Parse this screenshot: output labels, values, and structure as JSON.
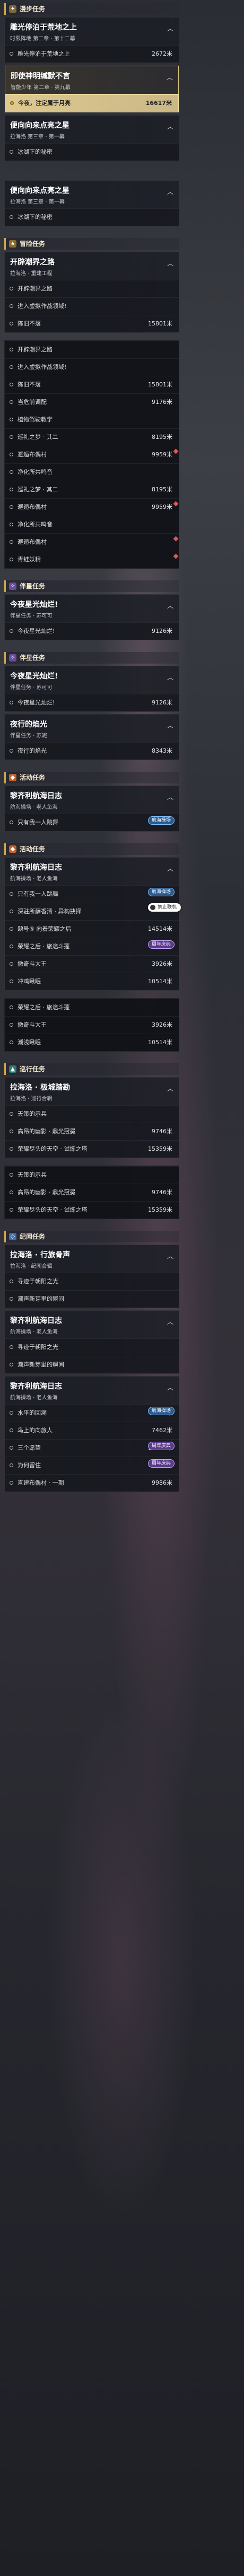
{
  "colors": {
    "accent_gold": "#cfa64a",
    "highlight": "#e8d296",
    "pin_red": "#e05555"
  },
  "s1": {
    "hdr": "漫步任务",
    "c1": {
      "title": "雕光停泊于荒地之上",
      "sub": "时限阵地 第二章 · 第十二幕",
      "rows": [
        {
          "t": "雕光停泊于荒地之上",
          "d": "2672米"
        }
      ]
    },
    "c2": {
      "title": "即使神明缄默不言",
      "sub": "智能少年 第二章 · 第九幕"
    },
    "c3": {
      "row": {
        "t": "今夜，注定属于月亮",
        "d": "16617米"
      }
    },
    "c4": {
      "title": "便向向来点亮之星",
      "sub": "拉海洛 第三章 · 第一幕",
      "rows": [
        {
          "t": "冰湖下的秘密",
          "d": ""
        }
      ]
    }
  },
  "s2": {
    "c1": {
      "title": "便向向来点亮之星",
      "sub": "拉海洛 第三章 · 第一幕",
      "rows": [
        {
          "t": "冰湖下的秘密",
          "d": ""
        }
      ]
    }
  },
  "s3": {
    "hdr": "冒险任务",
    "c1": {
      "title": "开辟潮界之路",
      "sub": "拉海洛 · 重建工程",
      "rows": [
        {
          "t": "开辟潮界之路",
          "d": ""
        },
        {
          "t": "进入虚拟作战领域!",
          "d": ""
        },
        {
          "t": "陈旧不落",
          "d": "15801米"
        }
      ]
    },
    "c2": {
      "rows": [
        {
          "t": "开辟潮界之路",
          "d": ""
        },
        {
          "t": "进入虚拟作战领域!",
          "d": ""
        },
        {
          "t": "陈旧不落",
          "d": "15801米"
        },
        {
          "t": "当危前调配",
          "d": "9176米"
        },
        {
          "t": "植物驾驶教学",
          "d": ""
        },
        {
          "t": "巡礼之梦 · 其二",
          "d": "8195米"
        },
        {
          "t": "邂逅布偶村",
          "d": "9959米"
        },
        {
          "t": "净化所共鸣音",
          "d": ""
        },
        {
          "t": "巡礼之梦 · 其二",
          "d": "8195米"
        },
        {
          "t": "邂逅布偶村",
          "d": "9959米"
        },
        {
          "t": "净化所共鸣音",
          "d": ""
        },
        {
          "t": "邂逅布偶村",
          "d": ""
        },
        {
          "t": "青蛙妖精",
          "d": ""
        }
      ]
    }
  },
  "s4": {
    "hdr": "伴星任务",
    "c1": {
      "title": "今夜星光灿烂!",
      "sub": "伴星任务 · 苏可可",
      "rows": [
        {
          "t": "今夜星光灿烂!",
          "d": "9126米"
        }
      ]
    }
  },
  "s5": {
    "hdr": "伴星任务",
    "c1": {
      "title": "今夜星光灿烂!",
      "sub": "伴星任务 · 苏可可",
      "rows": [
        {
          "t": "今夜星光灿烂!",
          "d": "9126米"
        }
      ]
    },
    "c2": {
      "title": "夜行的焰光",
      "sub": "伴星任务 · 苏妮",
      "rows": [
        {
          "t": "夜行的焰光",
          "d": "8343米"
        }
      ]
    }
  },
  "s6": {
    "hdr": "活动任务",
    "c1": {
      "title": "黎齐利航海日志",
      "sub": "航海操场 · 老人鱼海",
      "rows": [
        {
          "t": "只有我一人跳舞",
          "d": "7489米",
          "mkr": "航海操场"
        }
      ]
    }
  },
  "s7": {
    "hdr": "活动任务",
    "c1": {
      "title": "黎齐利航海日志",
      "sub": "航海操场 · 老人鱼海",
      "rows": [
        {
          "t": "只有我一人跳舞",
          "d": "7489米",
          "mkr": "航海操场"
        },
        {
          "t": "深驻所薛香清 · 异构抉择",
          "d": "",
          "btn": "禁止联机"
        },
        {
          "t": "题号⑤ 向着荣耀之后",
          "d": "14514米"
        },
        {
          "t": "荣耀之后 · 旅途斗蓬",
          "d": "",
          "mkr": "周年庆典"
        },
        {
          "t": "撒奇斗大王",
          "d": "3926米"
        },
        {
          "t": "冲鸡瞅眠",
          "d": "10514米"
        },
        {
          "t": "荣耀之后 · 旅途斗蓬",
          "d": ""
        },
        {
          "t": "撒奇斗大王",
          "d": "3926米"
        },
        {
          "t": "潮浅瞅眠",
          "d": "10514米"
        }
      ]
    }
  },
  "s8": {
    "hdr": "巡行任务",
    "c1": {
      "title": "拉海洛 · 极城踏勘",
      "sub": "拉海洛 · 巡行合辑",
      "rows": [
        {
          "t": "天策的示兵",
          "d": ""
        },
        {
          "t": "高昂的幽影 · 鼎光冠冕",
          "d": "9746米"
        },
        {
          "t": "荣耀尽头的天空 · 试炼之塔",
          "d": "15359米"
        },
        {
          "t": "天策的示兵",
          "d": ""
        },
        {
          "t": "高昂的幽影 · 鼎光冠冕",
          "d": "9746米"
        },
        {
          "t": "荣耀尽头的天空 · 试炼之塔",
          "d": "15359米"
        }
      ]
    }
  },
  "s9": {
    "hdr": "纪闻任务",
    "c1": {
      "title": "拉海洛 · 行旅骨声",
      "sub": "拉海洛 · 纪闻合辑",
      "rows": [
        {
          "t": "寻迹于朝阳之光",
          "d": ""
        },
        {
          "t": "潮声新芽里的瞬间",
          "d": ""
        }
      ]
    },
    "c2": {
      "title": "黎齐利航海日志",
      "sub": "航海操场 · 老人鱼海",
      "rows": [
        {
          "t": "寻迹于朝阳之光",
          "d": ""
        },
        {
          "t": "潮声新芽里的瞬间",
          "d": ""
        }
      ]
    },
    "c3": {
      "title": "黎齐利航海日志",
      "sub": "航海操场 · 老人鱼海",
      "rows": [
        {
          "t": "水平的回溯",
          "d": "7503米",
          "mkr": "航海操场"
        },
        {
          "t": "鸟上的向旅人",
          "d": "7462米"
        },
        {
          "t": "三个愿望",
          "d": "16252米",
          "mkr": "周年庆典"
        },
        {
          "t": "为何留住",
          "d": "16252米",
          "mkr": "周年庆典"
        },
        {
          "t": "直建布偶村 · 一期",
          "d": "9986米"
        }
      ]
    }
  }
}
